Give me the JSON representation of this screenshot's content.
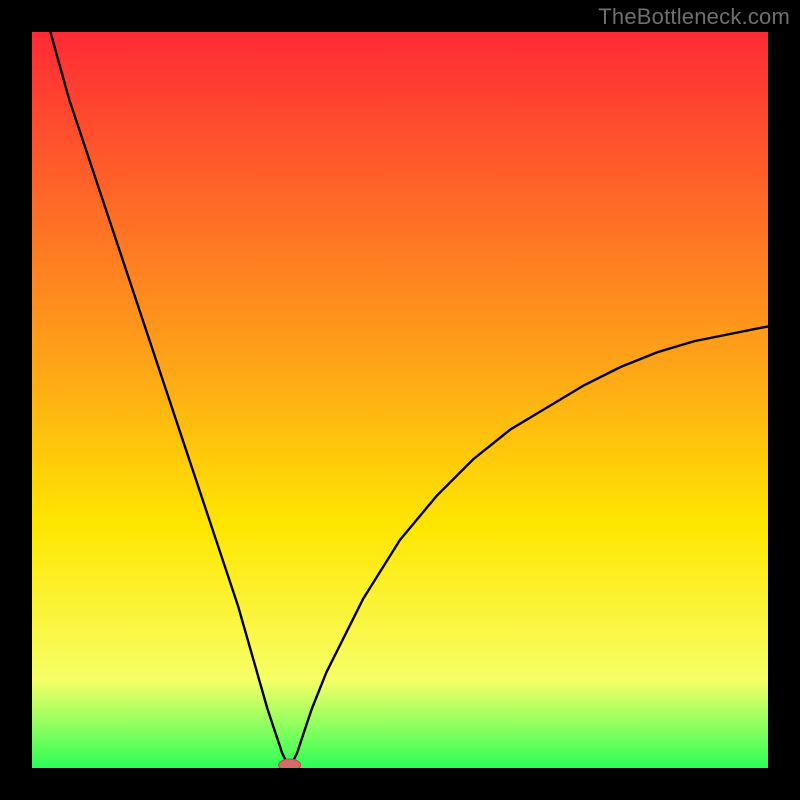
{
  "watermark": "TheBottleneck.com",
  "colors": {
    "frame_bg": "#000000",
    "gradient_top": "#ff2a36",
    "gradient_mid1": "#ffa418",
    "gradient_mid2": "#ffe600",
    "gradient_mid3": "#f7ff66",
    "gradient_bottom": "#2cff57",
    "curve": "#000000",
    "marker_fill": "#d46a6a",
    "marker_stroke": "#b94a4a"
  },
  "chart_data": {
    "type": "line",
    "title": "",
    "xlabel": "",
    "ylabel": "",
    "xlim": [
      0,
      100
    ],
    "ylim": [
      0,
      100
    ],
    "notes": "Bottleneck-style V curve. y ≈ 0 at x ≈ 35 (the optimal balance point). y rises steeply toward 100 as x → 0, and rises with diminishing slope toward ~60 as x → 100. Background is a vertical gradient from red (high bottleneck) through orange/yellow to green (low bottleneck).",
    "curve_points": [
      {
        "x": 2.5,
        "y": 100
      },
      {
        "x": 5,
        "y": 91
      },
      {
        "x": 10,
        "y": 76
      },
      {
        "x": 15,
        "y": 61
      },
      {
        "x": 20,
        "y": 46
      },
      {
        "x": 25,
        "y": 31
      },
      {
        "x": 28,
        "y": 22
      },
      {
        "x": 30,
        "y": 15
      },
      {
        "x": 32,
        "y": 8
      },
      {
        "x": 34,
        "y": 2
      },
      {
        "x": 35,
        "y": 0
      },
      {
        "x": 36,
        "y": 2
      },
      {
        "x": 38,
        "y": 8
      },
      {
        "x": 40,
        "y": 13
      },
      {
        "x": 45,
        "y": 23
      },
      {
        "x": 50,
        "y": 31
      },
      {
        "x": 55,
        "y": 37
      },
      {
        "x": 60,
        "y": 42
      },
      {
        "x": 65,
        "y": 46
      },
      {
        "x": 70,
        "y": 49
      },
      {
        "x": 75,
        "y": 52
      },
      {
        "x": 80,
        "y": 54.5
      },
      {
        "x": 85,
        "y": 56.5
      },
      {
        "x": 90,
        "y": 58
      },
      {
        "x": 95,
        "y": 59
      },
      {
        "x": 100,
        "y": 60
      }
    ],
    "minimum_marker": {
      "x": 35,
      "y": 0
    }
  }
}
